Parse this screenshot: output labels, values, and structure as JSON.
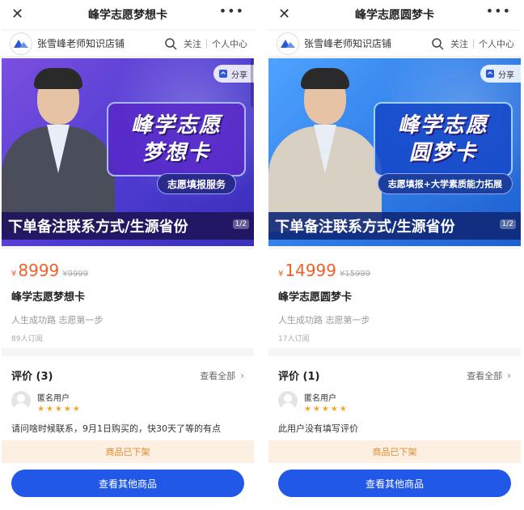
{
  "screens": [
    {
      "title": "峰学志愿梦想卡",
      "shop_name": "张雪峰老师知识店铺",
      "follow_label": "关注",
      "profile_label": "个人中心",
      "share_label": "分享",
      "banner": {
        "headline_1": "峰学志愿",
        "headline_2": "梦想卡",
        "subtag": "志愿填报服务",
        "strip": "下单备注联系方式/生源省份",
        "badge": "1/2"
      },
      "currency": "¥",
      "price": "8999",
      "price_original": "¥9999",
      "product_name": "峰学志愿梦想卡",
      "description": "人生成功路 志愿第一步",
      "subscribers": "89人订阅",
      "reviews_title": "评价 (3)",
      "reviews_view_all": "查看全部",
      "reviewer_name": "匿名用户",
      "review_stars": "★★★★★",
      "review_text": "请问啥时候联系，9月1日购买的，快30天了等的有点",
      "off_shelf_notice": "商品已下架",
      "cta_label": "查看其他商品"
    },
    {
      "title": "峰学志愿圆梦卡",
      "shop_name": "张雪峰老师知识店铺",
      "follow_label": "关注",
      "profile_label": "个人中心",
      "share_label": "分享",
      "banner": {
        "headline_1": "峰学志愿",
        "headline_2": "圆梦卡",
        "subtag": "志愿填报+大学素质能力拓展",
        "strip": "下单备注联系方式/生源省份",
        "badge": "1/2"
      },
      "currency": "¥",
      "price": "14999",
      "price_original": "¥15999",
      "product_name": "峰学志愿圆梦卡",
      "description": "人生成功路 志愿第一步",
      "subscribers": "17人订阅",
      "reviews_title": "评价 (1)",
      "reviews_view_all": "查看全部",
      "reviewer_name": "匿名用户",
      "review_stars": "★★★★★",
      "review_text": "此用户没有填写评价",
      "off_shelf_notice": "商品已下架",
      "cta_label": "查看其他商品"
    }
  ],
  "icons": {
    "close": "close-icon",
    "more": "more-icon",
    "search": "search-icon",
    "share": "share-icon",
    "chevron": "chevron-right-icon"
  },
  "colors": {
    "price": "#f0602a",
    "cta": "#2158e8",
    "off_shelf_bg": "#fdf0e2",
    "off_shelf_text": "#e5882a",
    "stars": "#f5a623"
  }
}
